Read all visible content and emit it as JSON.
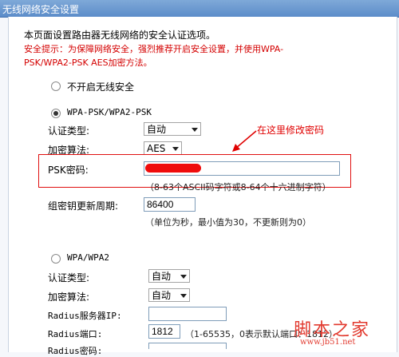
{
  "window": {
    "title": "无线网络安全设置"
  },
  "intro": "本页面设置路由器无线网络的安全认证选项。",
  "warning": {
    "line1": "安全提示：为保障网络安全，强烈推荐开启安全设置，并使用WPA-",
    "line2": "PSK/WPA2-PSK AES加密方法。"
  },
  "options": {
    "disable": {
      "label": "不开启无线安全",
      "checked": false
    },
    "wpa_psk": {
      "label": "WPA-PSK/WPA2-PSK",
      "checked": true
    },
    "wpa": {
      "label": "WPA/WPA2",
      "checked": false
    }
  },
  "psk_section": {
    "auth_type_label": "认证类型:",
    "auth_type_value": "自动",
    "encryption_label": "加密算法:",
    "encryption_value": "AES",
    "psk_label": "PSK密码:",
    "psk_value": "",
    "psk_hint": "（8-63个ASCII码字符或8-64个十六进制字符）",
    "rekey_label": "组密钥更新周期:",
    "rekey_value": "86400",
    "rekey_hint": "（单位为秒，最小值为30，不更新则为0）"
  },
  "annotation": {
    "text": "在这里修改密码",
    "color": "#e00000"
  },
  "wpa_section": {
    "auth_type_label": "认证类型:",
    "auth_type_value": "自动",
    "encryption_label": "加密算法:",
    "encryption_value": "自动",
    "radius_ip_label": "Radius服务器IP:",
    "radius_ip_value": "",
    "radius_port_label": "Radius端口:",
    "radius_port_value": "1812",
    "radius_port_hint": "（1-65535，0表示默认端口：1812）",
    "radius_pwd_label": "Radius密码:"
  },
  "watermark": {
    "big": "脚本之家",
    "small": "www.jb51.net"
  },
  "colors": {
    "accent_red": "#e01010",
    "titlebar": "#5b8cc9"
  }
}
